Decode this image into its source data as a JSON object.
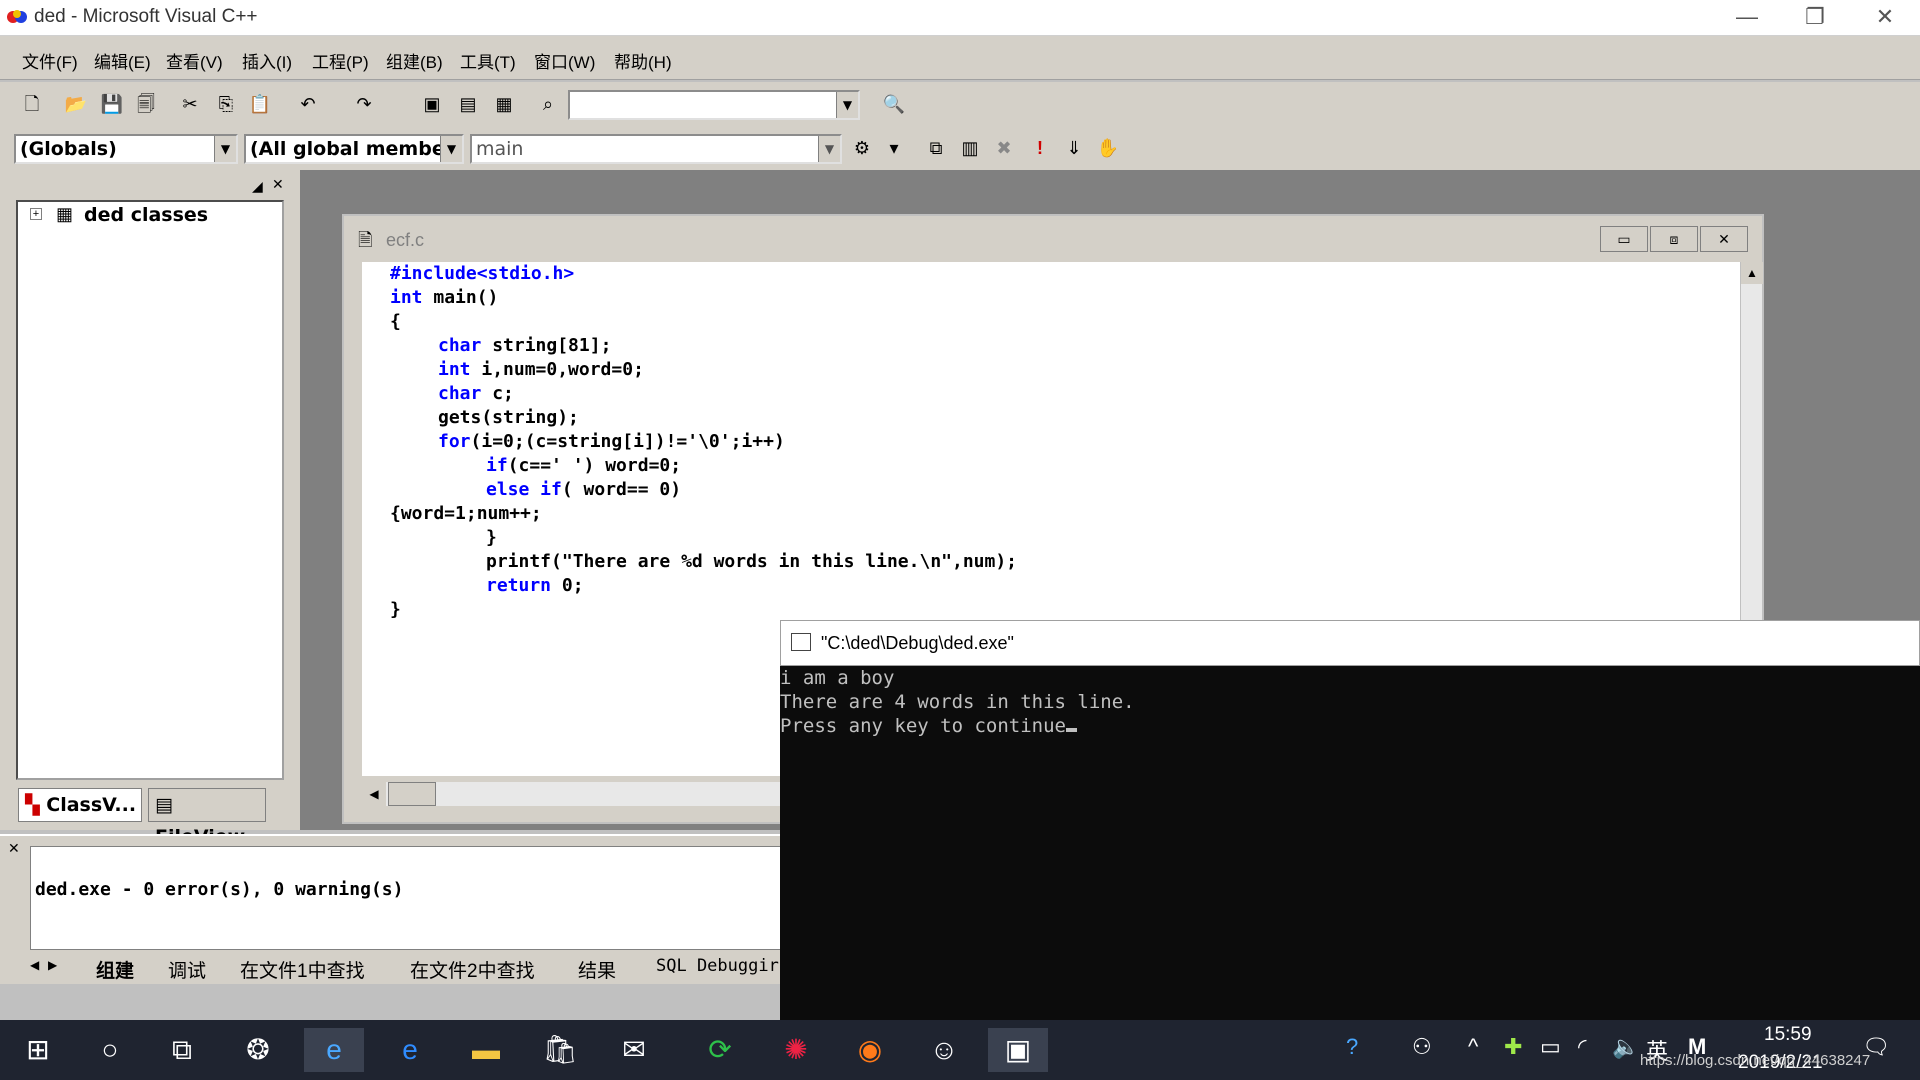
{
  "window": {
    "title": "ded - Microsoft Visual C++",
    "minimize_glyph": "—",
    "restore_glyph": "❐",
    "close_glyph": "✕"
  },
  "menu": [
    "文件(F)",
    "编辑(E)",
    "查看(V)",
    "插入(I)",
    "工程(P)",
    "组建(B)",
    "工具(T)",
    "窗口(W)",
    "帮助(H)"
  ],
  "toolbar2": {
    "globals": "(Globals)",
    "members": "(All global members",
    "function": "main"
  },
  "workspace": {
    "tree_root": "ded classes",
    "tab_classview": "ClassV...",
    "tab_fileview": "FileView"
  },
  "editor": {
    "title": "ecf.c"
  },
  "code": {
    "l1": "#include<stdio.h>",
    "l2_kw": "int",
    "l2": " main()",
    "l3": "{",
    "l4_kw": "char",
    "l4": " string[81];",
    "l5_kw": "int",
    "l5": " i,num=0,word=0;",
    "l6_kw": "char",
    "l6": " c;",
    "l7": "gets(string);",
    "l8_kw": "for",
    "l8": "(i=0;(c=string[i])!='\\0';i++)",
    "l9_kw": "if",
    "l9": "(c==' ') word=0;",
    "l10_kw": "else if",
    "l10": "( word== 0)",
    "l11": "{word=1;num++;",
    "l12": "}",
    "l13": "printf(\"There are %d words in this line.\\n\",num);",
    "l14_kw": "return",
    "l14": " 0;",
    "l15": "}"
  },
  "output": {
    "message": "ded.exe - 0 error(s), 0 warning(s)",
    "tabs": [
      "组建",
      "调试",
      "在文件1中查找",
      "在文件2中查找",
      "结果",
      "SQL Debuggir"
    ]
  },
  "console": {
    "title": "\"C:\\ded\\Debug\\ded.exe\"",
    "lines": [
      "i am a boy",
      "There are 4 words in this line.",
      "Press any key to continue"
    ]
  },
  "taskbar": {
    "time": "15:59",
    "date": "2019/2/21",
    "ime": "英",
    "watermark": "https://blog.csdn.net/qq_44638247"
  }
}
